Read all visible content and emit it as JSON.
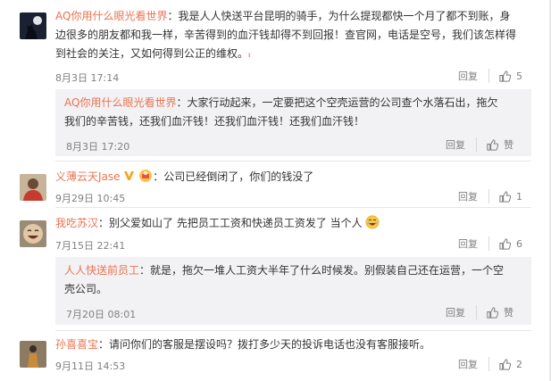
{
  "comments": [
    {
      "user": "AQ你用什么眼光看世界",
      "text_lines": [
        "：我是人人快送平台昆明的骑手，为什么提现都快一个月了都不到账，身",
        "边很多的朋友都和我一样，辛苦得到的血汗钱却得不到回报！查官网，电话是空号，我们该怎样得",
        "到社会的关注，又如何得到公正的维权。"
      ],
      "time": "8月3日 17:14",
      "reply_label": "回复",
      "like_label": "5",
      "reply": {
        "user": "AQ你用什么眼光看世界",
        "text_lines": [
          "：大家行动起来，一定要把这个空壳运营的公司查个水落石出，拖欠",
          "我们的辛苦钱，还我们血汗钱！还我们血汗钱！还我们血汗钱！"
        ],
        "time": "8月3日 17:20",
        "reply_label": "回复",
        "like_label": "赞"
      }
    },
    {
      "user": "义薄云天Jase",
      "text": "：公司已经倒闭了，你们的钱没了",
      "time": "9月29日 10:45",
      "reply_label": "回复",
      "like_label": "1"
    },
    {
      "user": "我吃苏汉",
      "text": "：别父爱如山了  先把员工工资和快递员工资发了  当个人",
      "time": "7月15日 22:41",
      "reply_label": "回复",
      "like_label": "6",
      "reply": {
        "user": "人人快送前员工",
        "text_lines": [
          "：就是，拖欠一堆人工资大半年了什么时候发。别假装自己还在运营，一个空",
          "壳公司。"
        ],
        "time": "7月20日 08:01",
        "reply_label": "回复",
        "like_label": "赞"
      }
    },
    {
      "user": "孙喜喜宝",
      "text": "：请问你们的客服是摆设吗？拨打多少天的投诉电话也没有客服接听。",
      "time": "9月11日 14:53",
      "reply_label": "回复",
      "like_label": "2"
    }
  ],
  "colors": {
    "username": "#eb7350",
    "meta": "#808080",
    "reply_bg": "#f2f2f5"
  },
  "icons": [
    "thumbs-up-icon",
    "verified-v-icon",
    "award-badge-icon",
    "laugh-emoji-icon"
  ]
}
